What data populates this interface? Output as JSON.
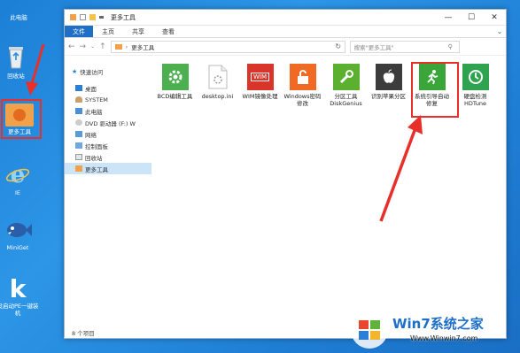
{
  "desktop": {
    "items": [
      {
        "label": "此电脑"
      },
      {
        "label": "回收站"
      },
      {
        "label": "更多工具"
      },
      {
        "label": "IE"
      },
      {
        "label": "MiniGet"
      },
      {
        "label": "没启动PE一键装机"
      }
    ]
  },
  "window": {
    "title": "更多工具",
    "ribbon_tabs": [
      "文件",
      "主页",
      "共享",
      "查看"
    ],
    "address_path": "更多工具",
    "search_placeholder": "搜索\"更多工具\"",
    "nav": [
      {
        "label": "快速访问"
      },
      {
        "label": "桌面"
      },
      {
        "label": "SYSTEM"
      },
      {
        "label": "此电脑"
      },
      {
        "label": "DVD 驱动器 (F:) W"
      },
      {
        "label": "网络"
      },
      {
        "label": "控制面板"
      },
      {
        "label": "回收站"
      },
      {
        "label": "更多工具"
      }
    ],
    "files": [
      {
        "label": "BCD编辑工具"
      },
      {
        "label": "desktop.ini"
      },
      {
        "label": "WIM镜像处理"
      },
      {
        "label": "Windows密码修改"
      },
      {
        "label": "分区工具DiskGenius"
      },
      {
        "label": "识别苹果分区"
      },
      {
        "label": "系统引导自动修复"
      },
      {
        "label": "硬盘检测HDTune"
      }
    ],
    "wim_badge": "WIM",
    "status": "8 个项目"
  },
  "watermark": {
    "brand": "Win7系统之家",
    "url": "Www.Winwin7.com"
  },
  "colors": {
    "desktop_blue": "#1f7fd5",
    "highlight_red": "#e8302a",
    "accent_blue": "#1e6fc5"
  }
}
